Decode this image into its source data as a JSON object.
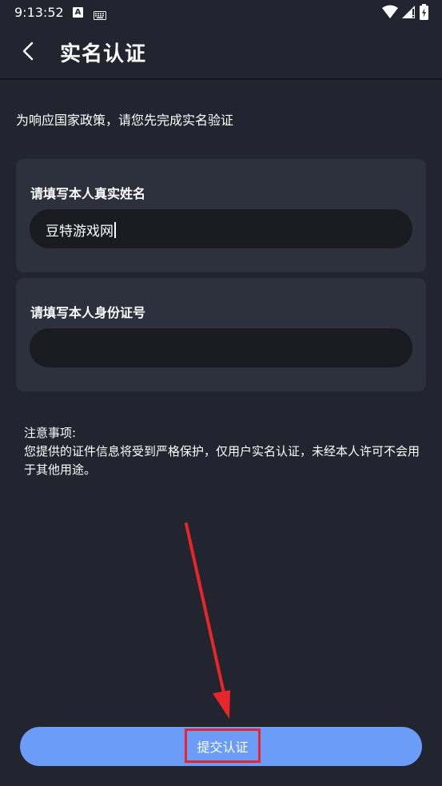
{
  "status_bar": {
    "time": "9:13:52",
    "a_badge": "A"
  },
  "header": {
    "title": "实名认证"
  },
  "policy_text": "为响应国家政策，请您先完成实名验证",
  "form": {
    "name": {
      "label": "请填写本人真实姓名",
      "value": "豆特游戏网"
    },
    "id_number": {
      "label": "请填写本人身份证号",
      "value": ""
    }
  },
  "notice": {
    "title": "注意事项:",
    "body": "您提供的证件信息将受到严格保护，仅用户实名认证，未经本人许可不会用于其他用途。"
  },
  "submit": {
    "label": "提交认证"
  },
  "colors": {
    "background": "#22242f",
    "card": "#2d303d",
    "input": "#1a1b21",
    "button": "#6a9cf8",
    "annotation": "#e8262a"
  }
}
